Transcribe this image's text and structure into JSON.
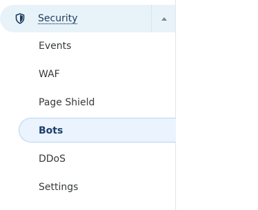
{
  "sidebar": {
    "group": {
      "label": "Security",
      "icon": "shield-icon",
      "expanded": true,
      "accent_color": "#1b3a5c"
    },
    "items": [
      {
        "label": "Events",
        "active": false
      },
      {
        "label": "WAF",
        "active": false
      },
      {
        "label": "Page Shield",
        "active": false
      },
      {
        "label": "Bots",
        "active": true
      },
      {
        "label": "DDoS",
        "active": false
      },
      {
        "label": "Settings",
        "active": false
      }
    ]
  }
}
